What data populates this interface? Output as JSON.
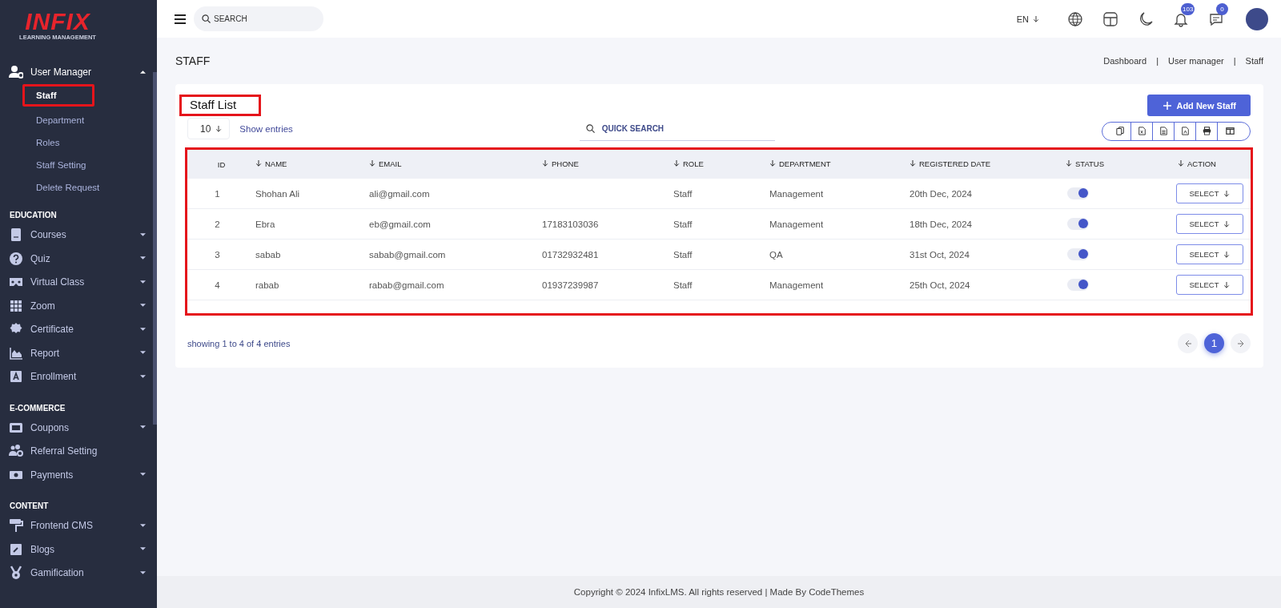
{
  "sidebar": {
    "logo": {
      "wordmark": "INFIX",
      "tagline": "LEARNING MANAGEMENT"
    },
    "sections": [
      {
        "items": [
          {
            "label": "User Manager",
            "expanded": true,
            "children": [
              {
                "label": "Staff",
                "selected": true,
                "highlighted": true
              },
              {
                "label": "Department",
                "selected": false,
                "highlighted": false
              },
              {
                "label": "Roles",
                "selected": false,
                "highlighted": false
              },
              {
                "label": "Staff Setting",
                "selected": false,
                "highlighted": false
              },
              {
                "label": "Delete Request",
                "selected": false,
                "highlighted": false
              }
            ]
          }
        ]
      },
      {
        "heading": "EDUCATION",
        "items": [
          {
            "label": "Courses",
            "expanded": false
          },
          {
            "label": "Quiz",
            "expanded": false
          },
          {
            "label": "Virtual Class",
            "expanded": false
          },
          {
            "label": "Zoom",
            "expanded": false
          },
          {
            "label": "Certificate",
            "expanded": false
          },
          {
            "label": "Report",
            "expanded": false
          },
          {
            "label": "Enrollment",
            "expanded": false
          }
        ]
      },
      {
        "heading": "E-COMMERCE",
        "items": [
          {
            "label": "Coupons",
            "expanded": false
          },
          {
            "label": "Referral Setting"
          },
          {
            "label": "Payments",
            "expanded": false
          }
        ]
      },
      {
        "heading": "CONTENT",
        "items": [
          {
            "label": "Frontend CMS",
            "expanded": false
          },
          {
            "label": "Blogs",
            "expanded": false
          },
          {
            "label": "Gamification",
            "expanded": false
          }
        ]
      }
    ]
  },
  "topbar": {
    "search": {
      "placeholder": "SEARCH"
    },
    "language": "EN",
    "notifications_badge": "103",
    "messages_badge": "0"
  },
  "page": {
    "title": "STAFF",
    "breadcrumb": [
      {
        "kind": "link",
        "text": "Dashboard"
      },
      {
        "kind": "separator",
        "text": "|"
      },
      {
        "kind": "link",
        "text": "User manager"
      },
      {
        "kind": "separator",
        "text": "|"
      },
      {
        "kind": "link",
        "text": "Staff"
      }
    ]
  },
  "card": {
    "title": "Staff List",
    "title_highlighted": true,
    "add_button": "Add New Staff",
    "page_size": "10",
    "show_entries": "Show entries",
    "quick_search": {
      "placeholder": "QUICK SEARCH"
    },
    "table": {
      "highlighted": true,
      "columns": [
        {
          "label": "ID",
          "sortable": false
        },
        {
          "label": "NAME",
          "sortable": true
        },
        {
          "label": "EMAIL",
          "sortable": true
        },
        {
          "label": "PHONE",
          "sortable": true
        },
        {
          "label": "ROLE",
          "sortable": true
        },
        {
          "label": "DEPARTMENT",
          "sortable": true
        },
        {
          "label": "REGISTERED DATE",
          "sortable": true
        },
        {
          "label": "STATUS",
          "sortable": true
        },
        {
          "label": "ACTION",
          "sortable": true
        }
      ],
      "rows": [
        {
          "id": "1",
          "name": "Shohan Ali",
          "email": "ali@gmail.com",
          "role": "Staff",
          "department": "Management",
          "registered": "20th Dec, 2024",
          "active": true,
          "action": "SELECT"
        },
        {
          "id": "2",
          "name": "Ebra",
          "email": "eb@gmail.com",
          "phone": "17183103036",
          "role": "Staff",
          "department": "Management",
          "registered": "18th Dec, 2024",
          "active": true,
          "action": "SELECT"
        },
        {
          "id": "3",
          "name": "sabab",
          "email": "sabab@gmail.com",
          "phone": "01732932481",
          "role": "Staff",
          "department": "QA",
          "registered": "31st Oct, 2024",
          "active": true,
          "action": "SELECT"
        },
        {
          "id": "4",
          "name": "rabab",
          "email": "rabab@gmail.com",
          "phone": "01937239987",
          "role": "Staff",
          "department": "Management",
          "registered": "25th Oct, 2024",
          "active": true,
          "action": "SELECT"
        }
      ]
    },
    "summary": "showing 1 to 4 of 4 entries",
    "pages": [
      {
        "label": "1",
        "selected": true
      }
    ]
  },
  "footer": {
    "text": "Copyright © 2024 InfixLMS. All rights reserved | Made By CodeThemes"
  }
}
